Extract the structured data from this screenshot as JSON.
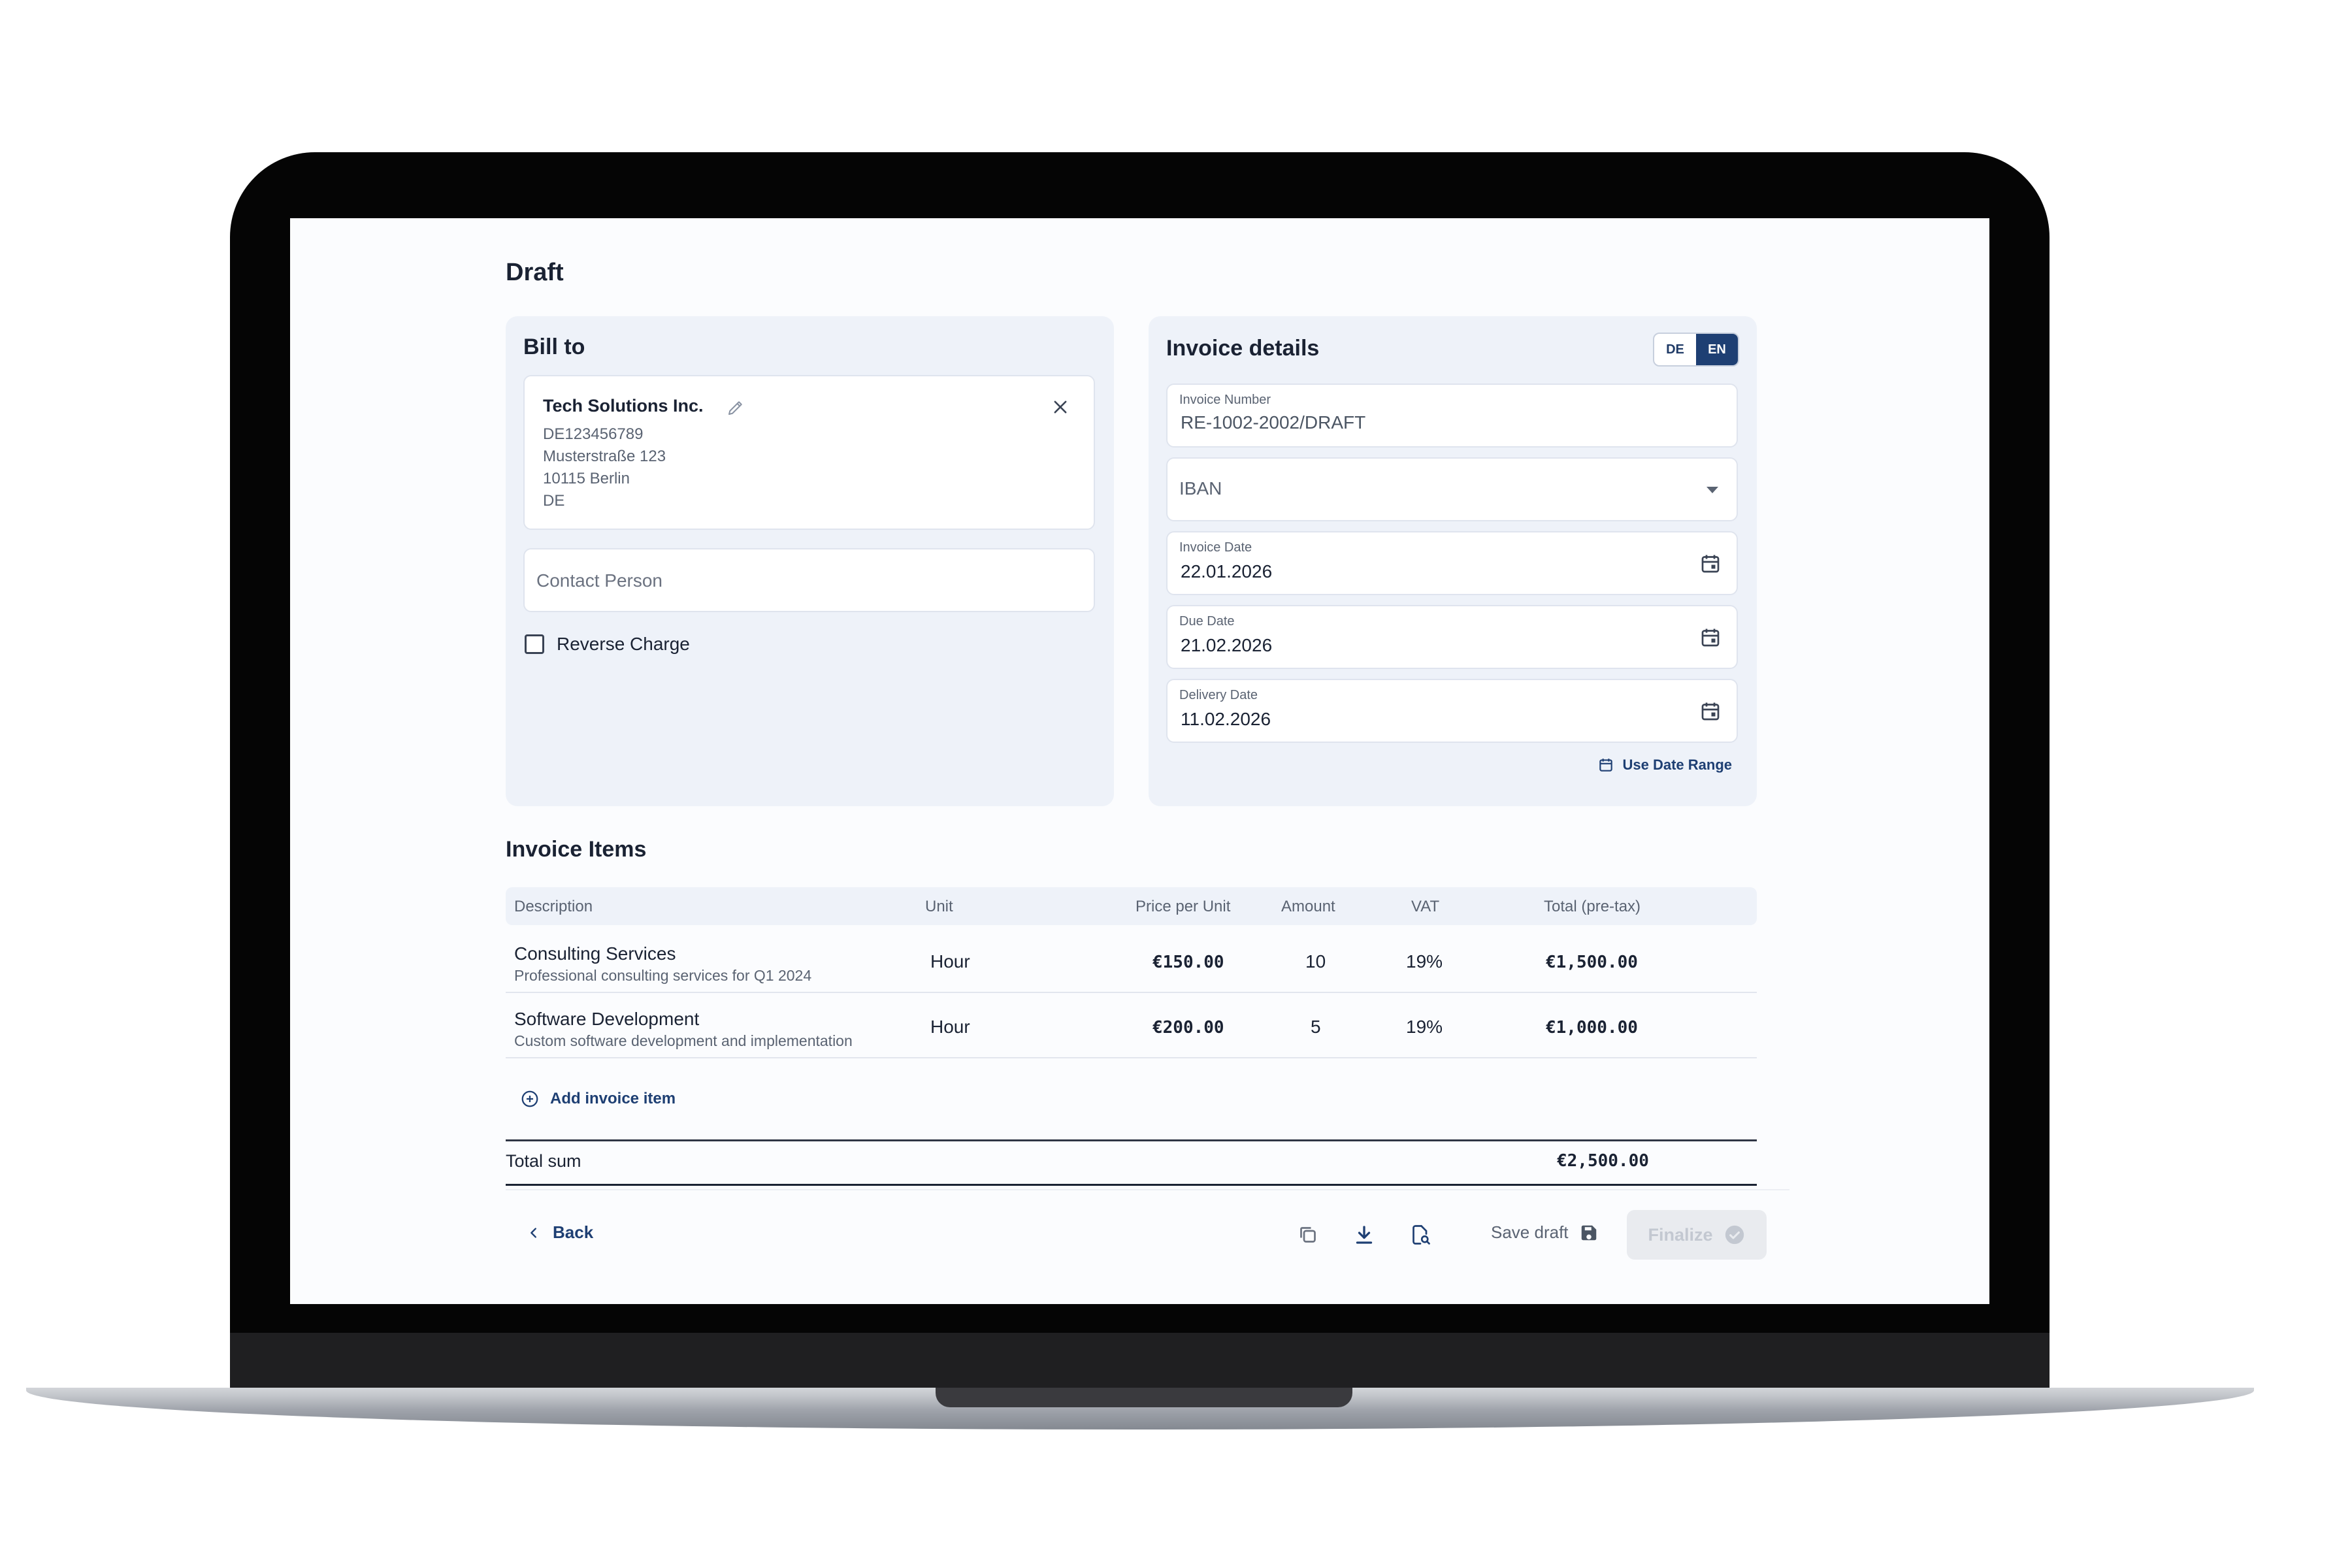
{
  "page": {
    "title": "Draft"
  },
  "bill_to": {
    "title": "Bill to",
    "client": {
      "name": "Tech Solutions Inc.",
      "vat_id": "DE123456789",
      "street": "Musterstraße 123",
      "city": "10115 Berlin",
      "country": "DE"
    },
    "contact_person": {
      "placeholder": "Contact Person",
      "value": ""
    },
    "reverse_charge": {
      "label": "Reverse Charge",
      "checked": false
    }
  },
  "invoice_details": {
    "title": "Invoice details",
    "languages": [
      "DE",
      "EN"
    ],
    "active_language": "EN",
    "invoice_number": {
      "label": "Invoice Number",
      "value": "RE-1002-2002/DRAFT"
    },
    "iban": {
      "placeholder": "IBAN"
    },
    "invoice_date": {
      "label": "Invoice Date",
      "value": "22.01.2026"
    },
    "due_date": {
      "label": "Due Date",
      "value": "21.02.2026"
    },
    "delivery_date": {
      "label": "Delivery Date",
      "value": "11.02.2026"
    },
    "date_range_label": "Use Date Range"
  },
  "items": {
    "title": "Invoice Items",
    "columns": [
      "Description",
      "Unit",
      "Price per Unit",
      "Amount",
      "VAT",
      "Total (pre-tax)"
    ],
    "rows": [
      {
        "description": "Consulting Services",
        "subtitle": "Professional consulting services for Q1 2024",
        "unit": "Hour",
        "price": "€150.00",
        "amount": "10",
        "vat": "19%",
        "total": "€1,500.00"
      },
      {
        "description": "Software Development",
        "subtitle": "Custom software development and implementation",
        "unit": "Hour",
        "price": "€200.00",
        "amount": "5",
        "vat": "19%",
        "total": "€1,000.00"
      }
    ],
    "add_label": "Add invoice item",
    "total_label": "Total sum",
    "total_value": "€2,500.00"
  },
  "footer": {
    "back_label": "Back",
    "save_draft_label": "Save draft",
    "finalize_label": "Finalize"
  },
  "colors": {
    "accent": "#1e3f73",
    "card_bg": "#eef2f9",
    "disabled": "#c3c8d1"
  }
}
